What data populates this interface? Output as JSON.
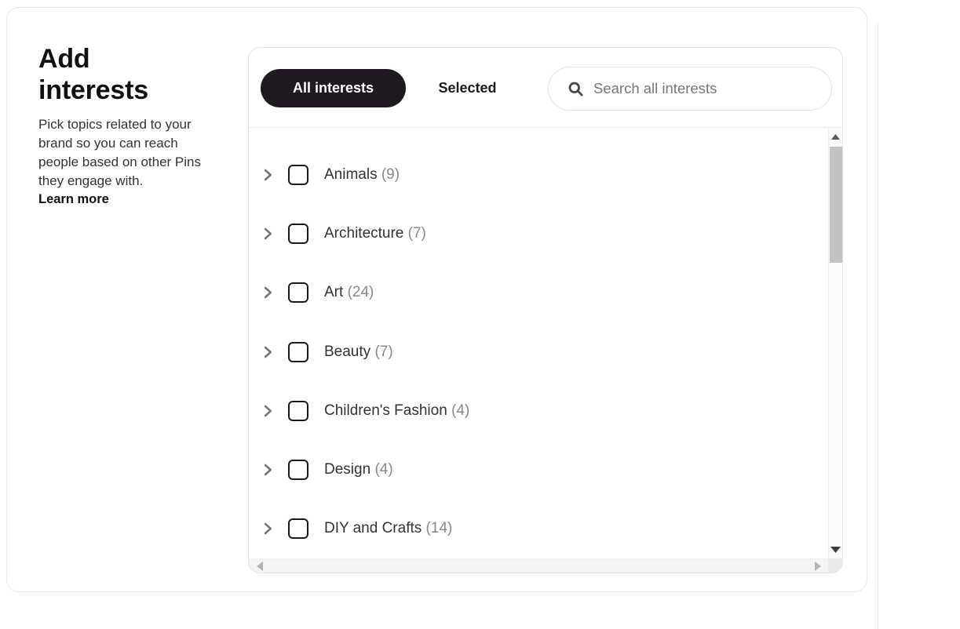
{
  "panel": {
    "title": "Add interests",
    "description": "Pick topics related to your brand so you can reach people based on other Pins they engage with.",
    "learn_more": "Learn more"
  },
  "tabs": [
    {
      "label": "All interests",
      "active": true
    },
    {
      "label": "Selected",
      "active": false
    }
  ],
  "search": {
    "placeholder": "Search all interests",
    "value": "",
    "icon": "search-icon"
  },
  "interests": [
    {
      "name": "Animals",
      "count": "(9)",
      "expand_icon": "chevron-right-icon",
      "checked": false
    },
    {
      "name": "Architecture",
      "count": "(7)",
      "expand_icon": "chevron-right-icon",
      "checked": false
    },
    {
      "name": "Art",
      "count": "(24)",
      "expand_icon": "chevron-right-icon",
      "checked": false
    },
    {
      "name": "Beauty",
      "count": "(7)",
      "expand_icon": "chevron-right-icon",
      "checked": false
    },
    {
      "name": "Children's Fashion",
      "count": "(4)",
      "expand_icon": "chevron-right-icon",
      "checked": false
    },
    {
      "name": "Design",
      "count": "(4)",
      "expand_icon": "chevron-right-icon",
      "checked": false
    },
    {
      "name": "DIY and Crafts",
      "count": "(14)",
      "expand_icon": "chevron-right-icon",
      "checked": false
    }
  ],
  "colors": {
    "tab_active_bg": "#211922",
    "tab_active_text": "#ffffff",
    "text_primary": "#211922",
    "text_secondary": "#333333",
    "count_gray": "#888888",
    "chevron_gray": "#767676",
    "border": "#e4e4e4",
    "scroll_thumb": "#c2c2c2"
  }
}
